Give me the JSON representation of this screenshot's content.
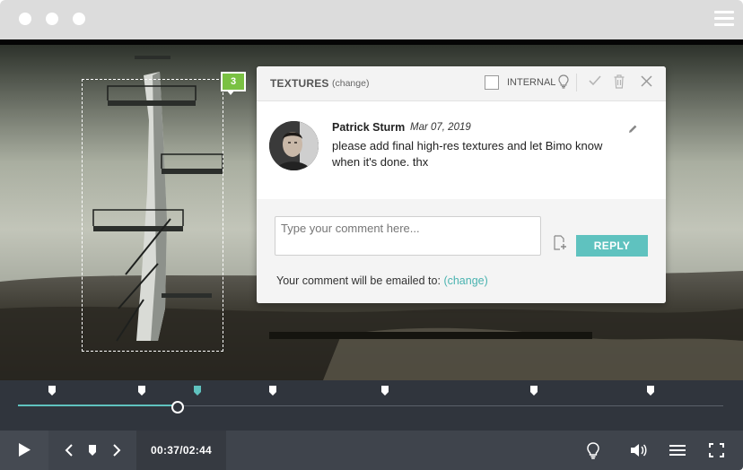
{
  "panel": {
    "title": "TEXTURES",
    "change_link": "(change)",
    "internal_label": "INTERNAL",
    "internal_checked": false
  },
  "pin": {
    "number": "3",
    "color": "#7ac143"
  },
  "comment": {
    "author": "Patrick Sturm",
    "date": "Mar 07, 2019",
    "lines": [
      "please add final high-res textures and let Bimo know",
      "when it's done. thx"
    ]
  },
  "reply": {
    "placeholder": "Type your comment here...",
    "button_label": "REPLY",
    "email_prefix": "Your comment will be emailed to: ",
    "email_change": "(change)"
  },
  "player": {
    "current_time": "00:37",
    "duration": "02:44",
    "time_display": "00:37/02:44",
    "progress_fraction": 0.2256,
    "accent_color": "#5fc2bf",
    "active_marker_index": 2
  },
  "icons": {
    "window_menu": "hamburger-icon",
    "header": [
      "lightbulb-icon",
      "check-icon",
      "trash-icon",
      "close-icon"
    ],
    "comment": [
      "pencil-icon"
    ],
    "reply": [
      "attach-file-icon"
    ],
    "controls": [
      "play-icon",
      "prev-icon",
      "marker-icon",
      "next-icon",
      "lightbulb-icon",
      "volume-icon",
      "list-icon",
      "fullscreen-icon"
    ]
  }
}
